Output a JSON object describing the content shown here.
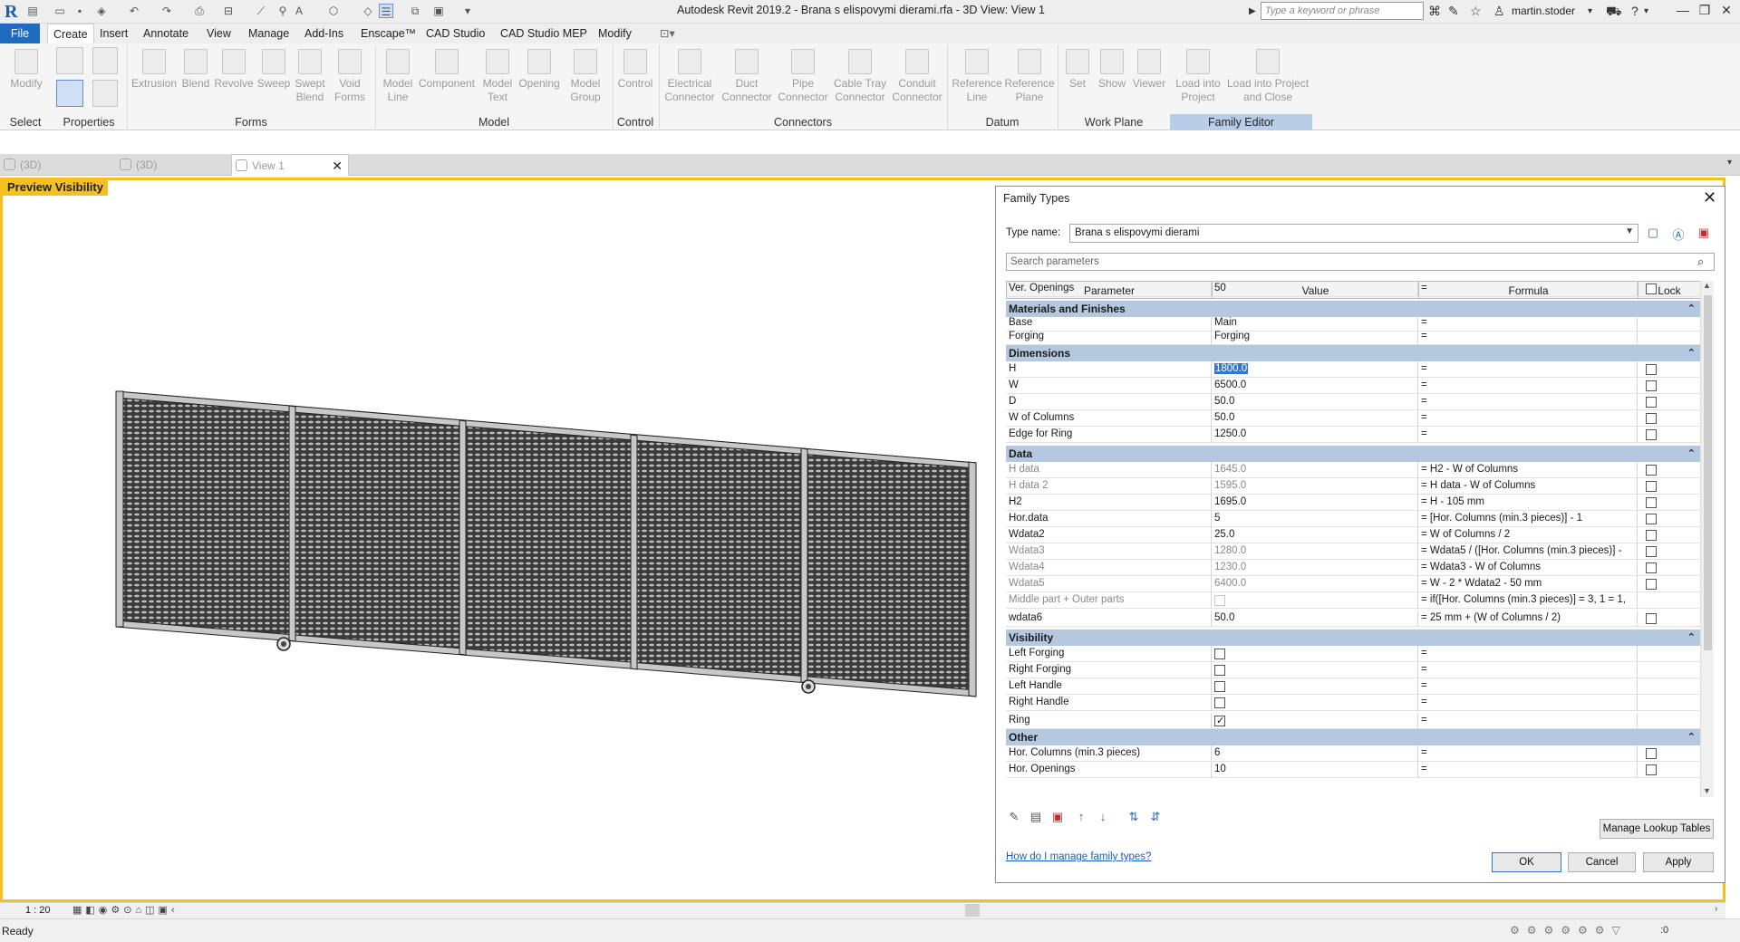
{
  "app": {
    "title": "Autodesk Revit 2019.2 - Brana s elispovymi dierami.rfa - 3D View: View 1",
    "search_placeholder": "Type a keyword or phrase",
    "username": "martin.stoder"
  },
  "menu": [
    "File",
    "Create",
    "Insert",
    "Annotate",
    "View",
    "Manage",
    "Add-Ins",
    "Enscape™",
    "CAD Studio",
    "CAD Studio MEP",
    "Modify"
  ],
  "ribbon": {
    "select": {
      "modify": "Modify",
      "label": "Select"
    },
    "properties": {
      "label": "Properties"
    },
    "forms": {
      "items": [
        "Extrusion",
        "Blend",
        "Revolve",
        "Sweep",
        "Swept Blend",
        "Void Forms"
      ],
      "label": "Forms"
    },
    "model": {
      "items": [
        "Model Line",
        "Component",
        "Model Text",
        "Opening",
        "Model Group"
      ],
      "label": "Model"
    },
    "control": {
      "items": [
        "Control"
      ],
      "label": "Control"
    },
    "connectors": {
      "items": [
        "Electrical Connector",
        "Duct Connector",
        "Pipe Connector",
        "Cable Tray Connector",
        "Conduit Connector"
      ],
      "label": "Connectors"
    },
    "datum": {
      "items": [
        "Reference Line",
        "Reference Plane"
      ],
      "label": "Datum"
    },
    "workplane": {
      "items": [
        "Set",
        "Show",
        "Viewer"
      ],
      "label": "Work Plane"
    },
    "family_editor": {
      "items": [
        "Load into Project",
        "Load into Project and Close"
      ],
      "label": "Family Editor"
    }
  },
  "view_tabs": [
    "(3D)",
    "(3D)",
    "View 1"
  ],
  "viewport": {
    "preview_label": "Preview Visibility",
    "scale": "1 : 20"
  },
  "dialog": {
    "title": "Family Types",
    "type_name_label": "Type name:",
    "type_name": "Brana s elispovymi dierami",
    "search_placeholder": "Search parameters",
    "columns": [
      "Parameter",
      "Value",
      "Formula",
      "Lock"
    ],
    "groups": [
      {
        "name": "Materials and Finishes",
        "rows": [
          {
            "param": "Base",
            "value": "Main",
            "formula": "=",
            "lock": null
          },
          {
            "param": "Forging",
            "value": "Forging",
            "formula": "=",
            "lock": null
          }
        ]
      },
      {
        "name": "Dimensions",
        "rows": [
          {
            "param": "H",
            "value": "1800.0",
            "formula": "=",
            "lock": false,
            "selected": true
          },
          {
            "param": "W",
            "value": "6500.0",
            "formula": "=",
            "lock": false
          },
          {
            "param": "D",
            "value": "50.0",
            "formula": "=",
            "lock": false
          },
          {
            "param": "W of Columns",
            "value": "50.0",
            "formula": "=",
            "lock": false
          },
          {
            "param": "Edge for Ring",
            "value": "1250.0",
            "formula": "=",
            "lock": false
          }
        ]
      },
      {
        "name": "Data",
        "rows": [
          {
            "param": "H data",
            "value": "1645.0",
            "formula": "= H2 - W of Columns",
            "lock": false,
            "gray": true
          },
          {
            "param": "H data 2",
            "value": "1595.0",
            "formula": "= H data - W of Columns",
            "lock": false,
            "gray": true
          },
          {
            "param": "H2",
            "value": "1695.0",
            "formula": "= H - 105 mm",
            "lock": false
          },
          {
            "param": "Hor.data",
            "value": "5",
            "formula": "= [Hor. Columns (min.3 pieces)] - 1",
            "lock": false
          },
          {
            "param": "Wdata2",
            "value": "25.0",
            "formula": "= W of Columns / 2",
            "lock": false
          },
          {
            "param": "Wdata3",
            "value": "1280.0",
            "formula": "= Wdata5 / ([Hor. Columns (min.3 pieces)] -",
            "lock": false,
            "gray": true
          },
          {
            "param": "Wdata4",
            "value": "1230.0",
            "formula": "= Wdata3 - W of Columns",
            "lock": false,
            "gray": true
          },
          {
            "param": "Wdata5",
            "value": "6400.0",
            "formula": "= W - 2 * Wdata2 - 50 mm",
            "lock": false,
            "gray": true
          },
          {
            "param": "Middle part + Outer parts",
            "value_check": "disabled",
            "formula": "= if([Hor. Columns (min.3 pieces)] = 3, 1 = 1,",
            "lock": null,
            "gray": true
          },
          {
            "param": "wdata6",
            "value": "50.0",
            "formula": "= 25 mm + (W of Columns / 2)",
            "lock": false
          }
        ]
      },
      {
        "name": "Visibility",
        "rows": [
          {
            "param": "Left Forging",
            "value_check": "off",
            "formula": "=",
            "lock": null
          },
          {
            "param": "Right Forging",
            "value_check": "off",
            "formula": "=",
            "lock": null
          },
          {
            "param": "Left Handle",
            "value_check": "off",
            "formula": "=",
            "lock": null
          },
          {
            "param": "Right Handle",
            "value_check": "off",
            "formula": "=",
            "lock": null
          },
          {
            "param": "Ring",
            "value_check": "on",
            "formula": "=",
            "lock": null
          }
        ]
      },
      {
        "name": "Other",
        "rows": [
          {
            "param": "Hor. Columns (min.3 pieces)",
            "value": "6",
            "formula": "=",
            "lock": false
          },
          {
            "param": "Hor. Openings",
            "value": "10",
            "formula": "=",
            "lock": false
          },
          {
            "param": "Ver. Openings",
            "value": "50",
            "formula": "=",
            "lock": false
          }
        ]
      }
    ],
    "manage_lookup": "Manage Lookup Tables",
    "help_link": "How do I manage family types?",
    "ok": "OK",
    "cancel": "Cancel",
    "apply": "Apply"
  },
  "status": {
    "text": "Ready"
  }
}
